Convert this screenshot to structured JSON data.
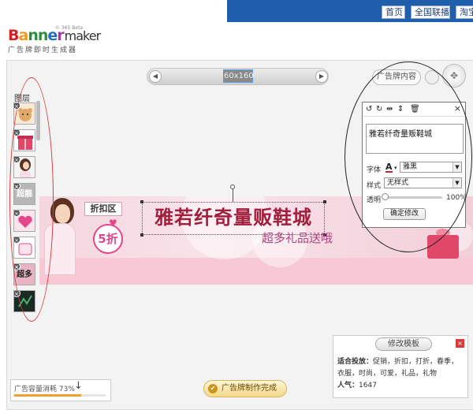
{
  "topnav": [
    "首页",
    "全国联播",
    "淘宝"
  ],
  "logo": {
    "main_b1": "B",
    "main_b2": "a",
    "main_b3": "nn",
    "main_b4": "e",
    "main_b5": "r",
    "maker": "maker",
    "beta": "© 365 Beta",
    "subtitle": "广告牌即时生成器"
  },
  "toolbar": {
    "size_label": "60x160",
    "prev": "◀",
    "next": "▶",
    "content_button": "广告牌内容"
  },
  "layers": {
    "title": "图层",
    "items": [
      "bear",
      "gift",
      "girl",
      "超靓",
      "heart",
      "sticker",
      "超多",
      "dark"
    ]
  },
  "banner": {
    "tag": "折扣区",
    "discount": "5折",
    "main_text": "雅若纤奇量贩鞋城",
    "sub_text": "超多礼品送哦"
  },
  "edit_panel": {
    "text_value": "雅若纤奇量贩鞋城",
    "font_label": "字体",
    "font_value": "雅黑",
    "style_label": "样式",
    "style_value": "无样式",
    "opacity_label": "透明",
    "opacity_value": "100%",
    "opacity_level": 1.0,
    "confirm_label": "确定修改",
    "close": "×"
  },
  "info": {
    "modify_button": "修改模板",
    "close": "×",
    "line1_label": "适合投放：",
    "line1_value": "促销，折扣，打折，春季，",
    "line2_value": "衣服，时尚，可爱，礼品，礼物",
    "popularity_label": "人气：",
    "popularity_value": "1647"
  },
  "capacity": {
    "label": "广告容量消耗 73%",
    "fraction": 0.73
  },
  "done_button": "广告牌制作完成",
  "colors": {
    "nav_blue": "#1f5eaa",
    "accent_red": "#d64040",
    "banner_text": "#a11e3c"
  }
}
